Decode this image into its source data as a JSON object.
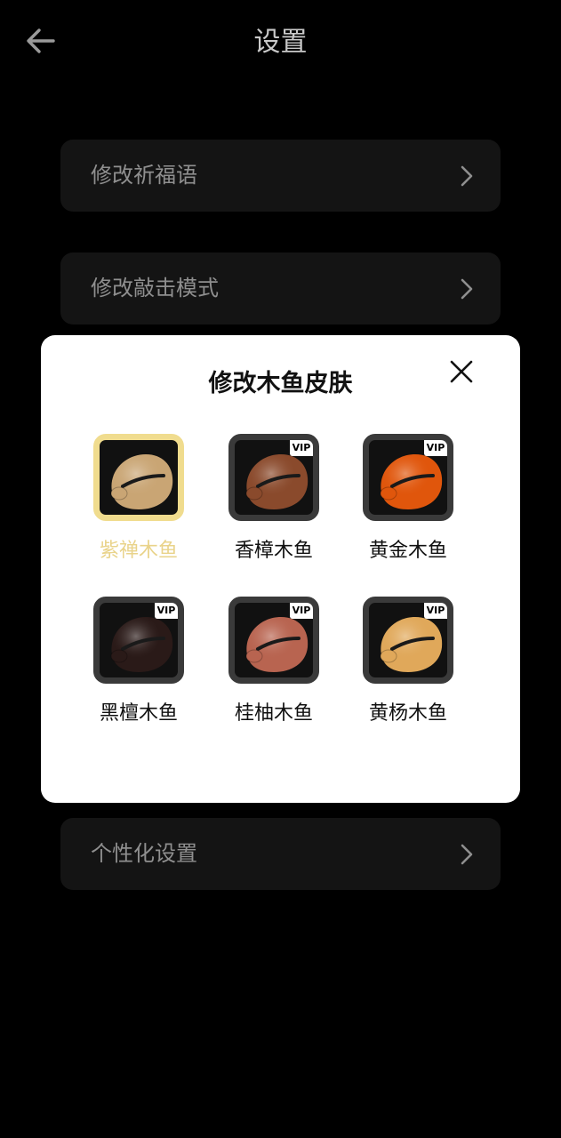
{
  "header": {
    "title": "设置"
  },
  "settings": {
    "items": [
      {
        "label": "修改祈福语"
      },
      {
        "label": "修改敲击模式"
      },
      {
        "label": "个性化设置"
      }
    ]
  },
  "modal": {
    "title": "修改木鱼皮肤",
    "skins": [
      {
        "label": "紫禅木鱼",
        "vip": "",
        "selected": true,
        "color": "#c9a574"
      },
      {
        "label": "香樟木鱼",
        "vip": "VIP",
        "selected": false,
        "color": "#8a4a2c"
      },
      {
        "label": "黄金木鱼",
        "vip": "VIP",
        "selected": false,
        "color": "#e0560c"
      },
      {
        "label": "黑檀木鱼",
        "vip": "VIP",
        "selected": false,
        "color": "#2a1a18"
      },
      {
        "label": "桂柚木鱼",
        "vip": "VIP",
        "selected": false,
        "color": "#b86450"
      },
      {
        "label": "黄杨木鱼",
        "vip": "VIP",
        "selected": false,
        "color": "#e0a85a"
      }
    ]
  },
  "colors": {
    "background": "#000000",
    "row_bg": "#141414",
    "row_text": "#8f8f8f",
    "selected_accent": "#f0dc8e",
    "modal_bg": "#ffffff"
  },
  "icons": {
    "back": "arrow-left-icon",
    "chevron": "chevron-right-icon",
    "close": "close-icon"
  }
}
